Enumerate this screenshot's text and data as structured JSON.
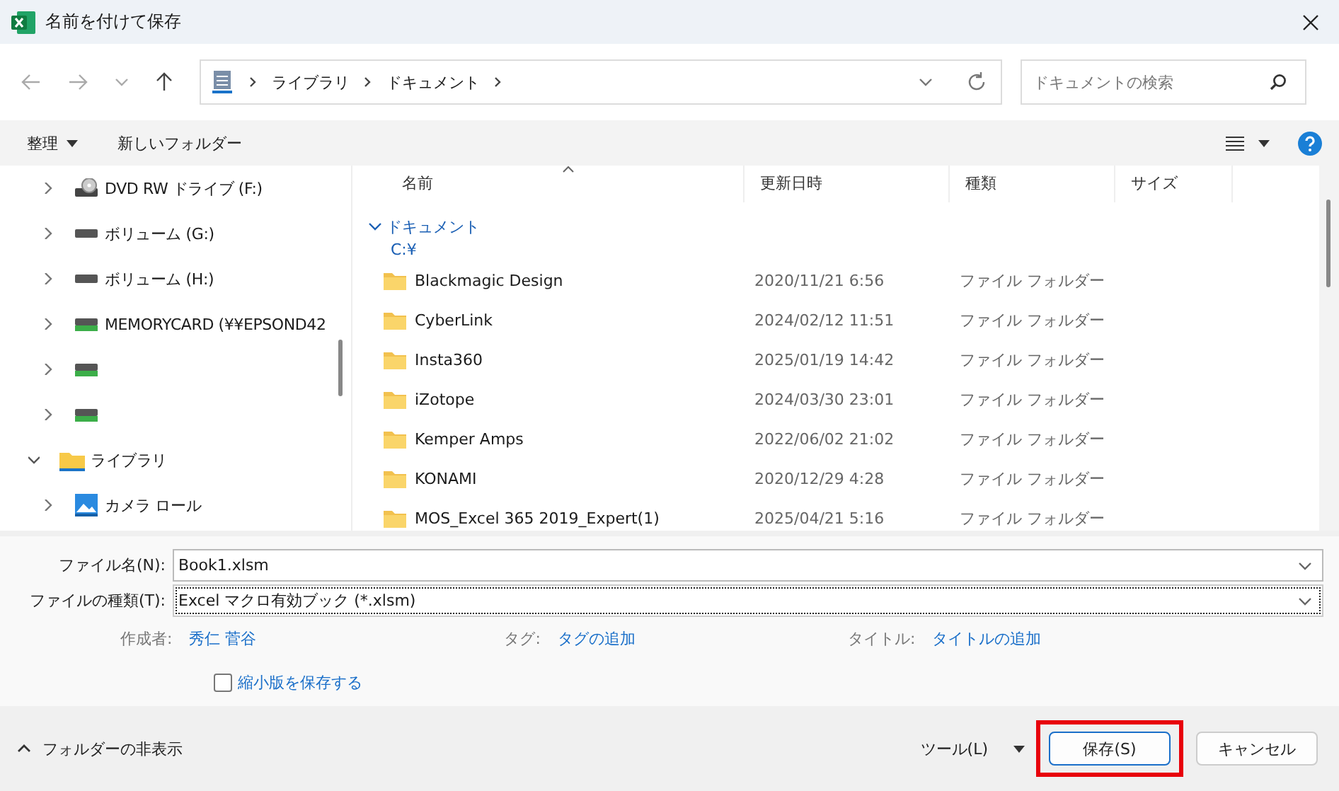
{
  "window": {
    "title": "名前を付けて保存"
  },
  "nav": {
    "breadcrumb": [
      "ライブラリ",
      "ドキュメント"
    ],
    "search_placeholder": "ドキュメントの検索"
  },
  "toolbar": {
    "organize": "整理",
    "new_folder": "新しいフォルダー"
  },
  "sidebar": {
    "items": [
      {
        "kind": "dvd",
        "label": "DVD RW ドライブ (F:)",
        "expanded": false
      },
      {
        "kind": "drive",
        "label": "ボリューム (G:)",
        "expanded": false
      },
      {
        "kind": "drive",
        "label": "ボリューム (H:)",
        "expanded": false
      },
      {
        "kind": "netdrive",
        "label": "MEMORYCARD (¥¥EPSOND42",
        "expanded": false
      },
      {
        "kind": "netdrive",
        "expanded": false
      },
      {
        "kind": "netdrive",
        "expanded": false
      },
      {
        "kind": "library",
        "label": "ライブラリ",
        "expanded": true,
        "children": [
          {
            "kind": "pictures",
            "label": "カメラ ロール",
            "expanded": false
          }
        ]
      }
    ]
  },
  "file_list": {
    "columns": [
      "名前",
      "更新日時",
      "種類",
      "サイズ"
    ],
    "group": {
      "title": "ドキュメント",
      "path": "C:¥",
      "expanded": true
    },
    "rows": [
      {
        "name": "Blackmagic Design",
        "modified": "2020/11/21 6:56",
        "type": "ファイル フォルダー"
      },
      {
        "name": "CyberLink",
        "modified": "2024/02/12 11:51",
        "type": "ファイル フォルダー"
      },
      {
        "name": "Insta360",
        "modified": "2025/01/19 14:42",
        "type": "ファイル フォルダー"
      },
      {
        "name": "iZotope",
        "modified": "2024/03/30 23:01",
        "type": "ファイル フォルダー"
      },
      {
        "name": "Kemper Amps",
        "modified": "2022/06/02 21:02",
        "type": "ファイル フォルダー"
      },
      {
        "name": "KONAMI",
        "modified": "2020/12/29 4:28",
        "type": "ファイル フォルダー"
      },
      {
        "name": "MOS_Excel 365 2019_Expert(1)",
        "modified": "2025/04/21 5:16",
        "type": "ファイル フォルダー"
      }
    ]
  },
  "form": {
    "filename_label": "ファイル名(N):",
    "filename": "Book1.xlsm",
    "filetype_label": "ファイルの種類(T):",
    "filetype": "Excel マクロ有効ブック (*.xlsm)",
    "author_label": "作成者:",
    "author": "秀仁 菅谷",
    "tags_label": "タグ:",
    "tags": "タグの追加",
    "title_label": "タイトル:",
    "title": "タイトルの追加",
    "thumbnail": {
      "label": "縮小版を保存する",
      "checked": false
    }
  },
  "footer": {
    "hide_folders": "フォルダーの非表示",
    "tools": "ツール(L)",
    "buttons": [
      {
        "label": "保存(S)",
        "kind": "primary",
        "highlighted": true
      },
      {
        "label": "キャンセル",
        "kind": "secondary",
        "highlighted": false
      }
    ]
  }
}
